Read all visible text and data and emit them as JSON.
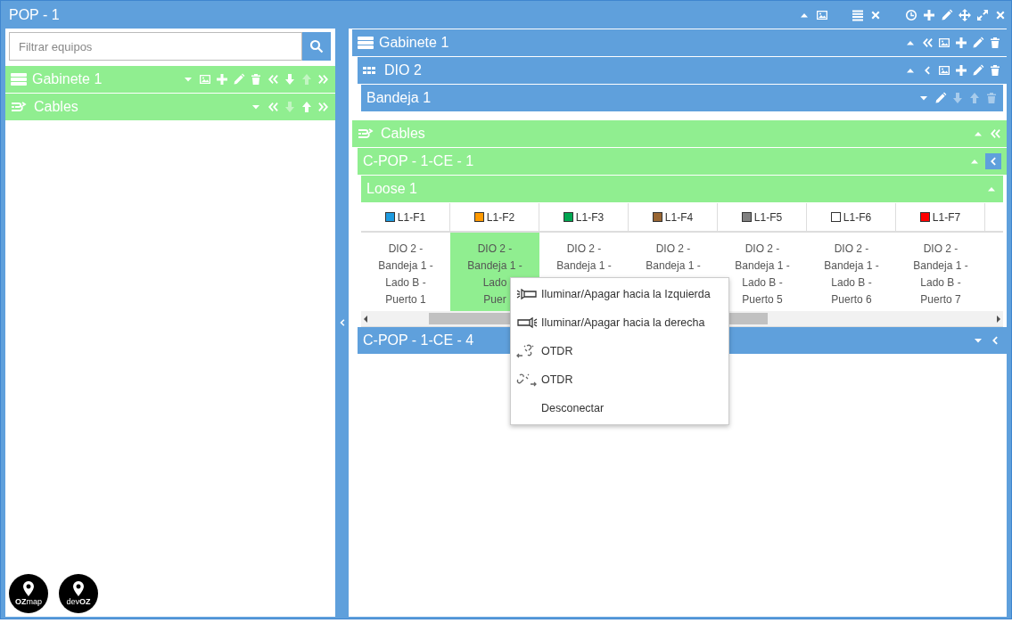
{
  "window": {
    "title": "POP - 1",
    "actions": [
      {
        "kind": "collapse",
        "disabled": false
      },
      {
        "kind": "image",
        "disabled": false
      },
      {
        "kind": "list",
        "disabled": false
      },
      {
        "kind": "close",
        "disabled": false
      },
      {
        "kind": "clock",
        "disabled": false
      },
      {
        "kind": "add",
        "disabled": false
      },
      {
        "kind": "edit",
        "disabled": false
      },
      {
        "kind": "move",
        "disabled": false
      },
      {
        "kind": "fullscreen",
        "disabled": false
      },
      {
        "kind": "close",
        "disabled": false
      }
    ]
  },
  "search": {
    "placeholder": "Filtrar equipos"
  },
  "tree": [
    {
      "title": "Gabinete 1",
      "kind": "rack",
      "color": "#90ee90",
      "actions": [
        {
          "kind": "expand",
          "disabled": false
        },
        {
          "kind": "image",
          "disabled": false
        },
        {
          "kind": "add",
          "disabled": false
        },
        {
          "kind": "edit",
          "disabled": false
        },
        {
          "kind": "delete",
          "disabled": false
        },
        {
          "kind": "first",
          "disabled": false
        },
        {
          "kind": "down",
          "disabled": false
        },
        {
          "kind": "up",
          "disabled": true
        },
        {
          "kind": "last",
          "disabled": false
        }
      ]
    },
    {
      "title": "Cables",
      "kind": "cable",
      "color": "#90ee90",
      "actions": [
        {
          "kind": "expand",
          "disabled": false
        },
        {
          "kind": "first",
          "disabled": false
        },
        {
          "kind": "down",
          "disabled": true
        },
        {
          "kind": "up",
          "disabled": false
        },
        {
          "kind": "last",
          "disabled": false
        }
      ]
    }
  ],
  "panels": [
    {
      "title": "Gabinete 1",
      "kind": "rack",
      "color": "#5fa0dc",
      "actions": [
        {
          "kind": "collapse",
          "disabled": false
        },
        {
          "kind": "first",
          "disabled": false
        },
        {
          "kind": "image",
          "disabled": false
        },
        {
          "kind": "add",
          "disabled": false
        },
        {
          "kind": "edit",
          "disabled": false
        },
        {
          "kind": "delete",
          "disabled": false
        }
      ],
      "children": [
        {
          "title": "DIO 2",
          "kind": "panel",
          "color": "#5fa0dc",
          "actions": [
            {
              "kind": "collapse",
              "disabled": false
            },
            {
              "kind": "back",
              "disabled": false
            },
            {
              "kind": "image",
              "disabled": false
            },
            {
              "kind": "add",
              "disabled": false
            },
            {
              "kind": "edit",
              "disabled": false
            },
            {
              "kind": "delete",
              "disabled": false
            }
          ],
          "children": [
            {
              "title": "Bandeja 1",
              "color": "#5fa0dc",
              "actions": [
                {
                  "kind": "expand",
                  "disabled": false
                },
                {
                  "kind": "edit",
                  "disabled": false
                },
                {
                  "kind": "down",
                  "disabled": true
                },
                {
                  "kind": "up",
                  "disabled": true
                },
                {
                  "kind": "delete",
                  "disabled": true
                }
              ]
            }
          ]
        }
      ]
    },
    {
      "title": "Cables",
      "kind": "cable",
      "color": "#90ee90",
      "actions": [
        {
          "kind": "collapse",
          "disabled": false
        },
        {
          "kind": "first",
          "disabled": false
        }
      ],
      "children": [
        {
          "title": "C-POP - 1-CE - 1",
          "color": "#90ee90",
          "actions": [
            {
              "kind": "collapse",
              "disabled": false,
              "highlighted": false
            },
            {
              "kind": "back",
              "disabled": false,
              "highlighted": true
            }
          ],
          "children": [
            {
              "title": "Loose 1",
              "color": "#90ee90",
              "actions": [
                {
                  "kind": "collapse",
                  "disabled": false
                }
              ],
              "fibers": [
                {
                  "label": "L1-F1",
                  "color": "#1e9be0",
                  "selected": false,
                  "text": "DIO 2 -\nBandeja 1 -\nLado B -\nPuerto 1"
                },
                {
                  "label": "L1-F2",
                  "color": "#ff9900",
                  "selected": true,
                  "text": "DIO 2 -\nBandeja 1 -\nLado\nPuer"
                },
                {
                  "label": "L1-F3",
                  "color": "#00a651",
                  "selected": false,
                  "text": "DIO 2 -\nBandeja 1 -"
                },
                {
                  "label": "L1-F4",
                  "color": "#996633",
                  "selected": false,
                  "text": "DIO 2 -\nBandeja 1 -"
                },
                {
                  "label": "L1-F5",
                  "color": "#808080",
                  "selected": false,
                  "text": "DIO 2 -\nBandeja 1 -\nLado B -\nPuerto 5"
                },
                {
                  "label": "L1-F6",
                  "color": "#ffffff",
                  "selected": false,
                  "text": "DIO 2 -\nBandeja 1 -\nLado B -\nPuerto 6"
                },
                {
                  "label": "L1-F7",
                  "color": "#ff0000",
                  "selected": false,
                  "text": "DIO 2 -\nBandeja 1 -\nLado B -\nPuerto 7"
                }
              ]
            }
          ]
        },
        {
          "title": "C-POP - 1-CE - 4",
          "color": "#5fa0dc",
          "actions": [
            {
              "kind": "expand",
              "disabled": false
            },
            {
              "kind": "back",
              "disabled": false
            }
          ]
        }
      ]
    }
  ],
  "menu": [
    {
      "kind": "light-left",
      "label": "Iluminar/Apagar hacia la Izquierda"
    },
    {
      "kind": "light-right",
      "label": "Iluminar/Apagar hacia la derecha"
    },
    {
      "kind": "otdr-left",
      "label": "OTDR"
    },
    {
      "kind": "otdr-right",
      "label": "OTDR"
    },
    {
      "kind": "plain",
      "label": "Desconectar"
    }
  ],
  "logos": [
    {
      "text": "**OZ**map"
    },
    {
      "text": "dev**OZ**"
    }
  ]
}
